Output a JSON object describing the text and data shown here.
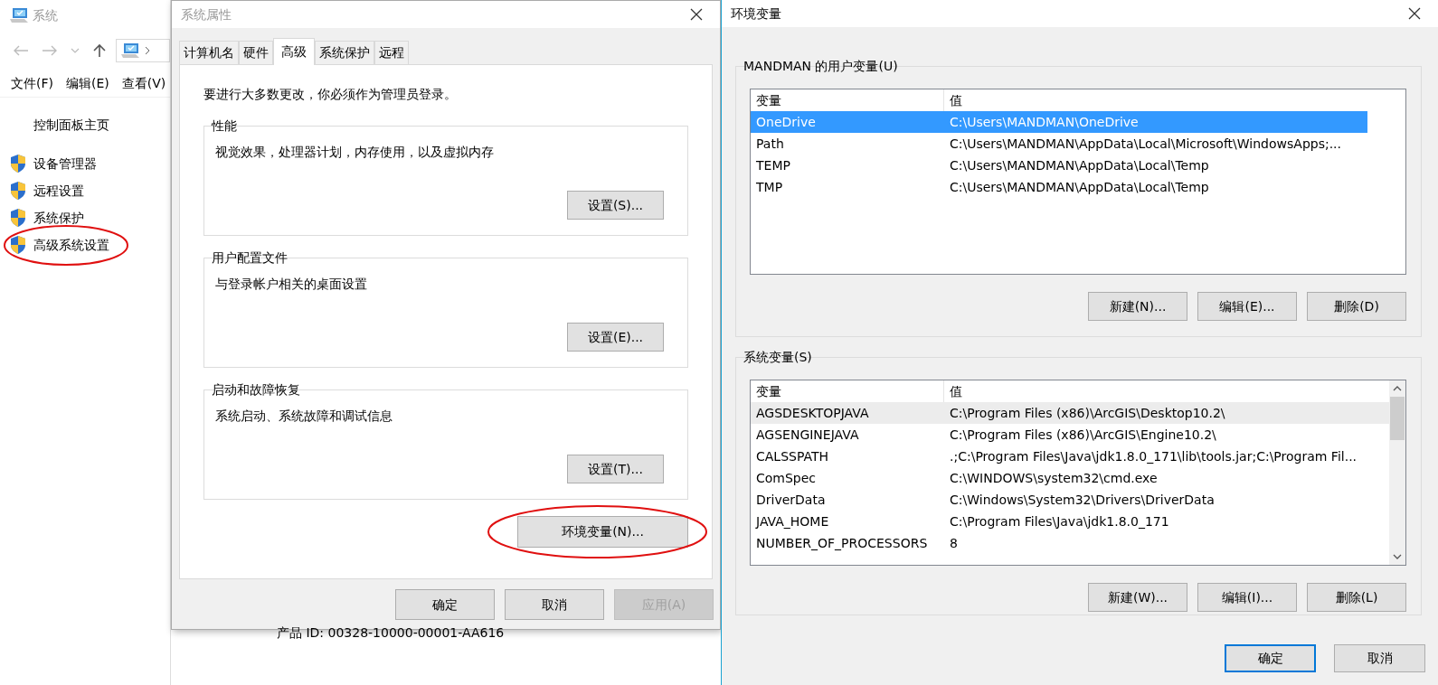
{
  "control_panel": {
    "title": "系统",
    "menu": [
      "文件(F)",
      "编辑(E)",
      "查看(V)"
    ],
    "home_link": "控制面板主页",
    "tasks": [
      {
        "label": "设备管理器",
        "circled": false
      },
      {
        "label": "远程设置",
        "circled": false
      },
      {
        "label": "系统保护",
        "circled": false
      },
      {
        "label": "高级系统设置",
        "circled": true
      }
    ],
    "product_id": "产品 ID: 00328-10000-00001-AA616"
  },
  "system_properties": {
    "title": "系统属性",
    "tabs": [
      {
        "label": "计算机名",
        "selected": false
      },
      {
        "label": "硬件",
        "selected": false
      },
      {
        "label": "高级",
        "selected": true
      },
      {
        "label": "系统保护",
        "selected": false
      },
      {
        "label": "远程",
        "selected": false
      }
    ],
    "notice": "要进行大多数更改，你必须作为管理员登录。",
    "groups": [
      {
        "title": "性能",
        "description": "视觉效果，处理器计划，内存使用，以及虚拟内存",
        "button": "设置(S)..."
      },
      {
        "title": "用户配置文件",
        "description": "与登录帐户相关的桌面设置",
        "button": "设置(E)..."
      },
      {
        "title": "启动和故障恢复",
        "description": "系统启动、系统故障和调试信息",
        "button": "设置(T)..."
      }
    ],
    "env_button": {
      "label": "环境变量(N)...",
      "circled": true
    },
    "buttons": [
      {
        "label": "确定",
        "disabled": false
      },
      {
        "label": "取消",
        "disabled": false
      },
      {
        "label": "应用(A)",
        "disabled": true
      }
    ]
  },
  "environment_variables": {
    "title": "环境变量",
    "user_group": {
      "title": "MANDMAN 的用户变量(U)",
      "columns": [
        "变量",
        "值"
      ],
      "rows": [
        {
          "name": "OneDrive",
          "value": "C:\\Users\\MANDMAN\\OneDrive",
          "selected": true
        },
        {
          "name": "Path",
          "value": "C:\\Users\\MANDMAN\\AppData\\Local\\Microsoft\\WindowsApps;...",
          "selected": false
        },
        {
          "name": "TEMP",
          "value": "C:\\Users\\MANDMAN\\AppData\\Local\\Temp",
          "selected": false
        },
        {
          "name": "TMP",
          "value": "C:\\Users\\MANDMAN\\AppData\\Local\\Temp",
          "selected": false
        }
      ],
      "buttons": [
        "新建(N)...",
        "编辑(E)...",
        "删除(D)"
      ]
    },
    "system_group": {
      "title": "系统变量(S)",
      "columns": [
        "变量",
        "值"
      ],
      "rows": [
        {
          "name": "AGSDESKTOPJAVA",
          "value": "C:\\Program Files (x86)\\ArcGIS\\Desktop10.2\\",
          "hovered": true
        },
        {
          "name": "AGSENGINEJAVA",
          "value": "C:\\Program Files (x86)\\ArcGIS\\Engine10.2\\",
          "hovered": false
        },
        {
          "name": "CALSSPATH",
          "value": ".;C:\\Program Files\\Java\\jdk1.8.0_171\\lib\\tools.jar;C:\\Program Fil...",
          "hovered": false
        },
        {
          "name": "ComSpec",
          "value": "C:\\WINDOWS\\system32\\cmd.exe",
          "hovered": false
        },
        {
          "name": "DriverData",
          "value": "C:\\Windows\\System32\\Drivers\\DriverData",
          "hovered": false
        },
        {
          "name": "JAVA_HOME",
          "value": "C:\\Program Files\\Java\\jdk1.8.0_171",
          "hovered": false
        },
        {
          "name": "NUMBER_OF_PROCESSORS",
          "value": "8",
          "hovered": false
        }
      ],
      "buttons": [
        "新建(W)...",
        "编辑(I)...",
        "删除(L)"
      ]
    },
    "buttons": [
      {
        "label": "确定",
        "default": true
      },
      {
        "label": "取消",
        "default": false
      }
    ]
  }
}
